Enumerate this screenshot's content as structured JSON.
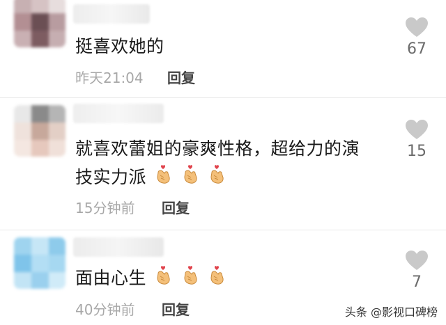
{
  "comments": [
    {
      "text_lines": [
        "挺喜欢她的"
      ],
      "emoji_count": 0,
      "time": "昨天21:04",
      "reply_label": "回复",
      "likes": "67"
    },
    {
      "text_lines": [
        "就喜欢蕾姐的豪爽性格，超给力的演",
        "技实力派"
      ],
      "emoji_count": 3,
      "time": "15分钟前",
      "reply_label": "回复",
      "likes": "15"
    },
    {
      "text_lines": [
        "面由心生"
      ],
      "emoji_count": 3,
      "time": "40分钟前",
      "reply_label": "回复",
      "likes": "7"
    }
  ],
  "emoji_icon": "finger-heart-emoji",
  "watermark": "头条 @影视口碑榜",
  "colors": {
    "text": "#1a1a1a",
    "meta": "#a8a8a8",
    "like_icon": "#c9c9c9"
  }
}
